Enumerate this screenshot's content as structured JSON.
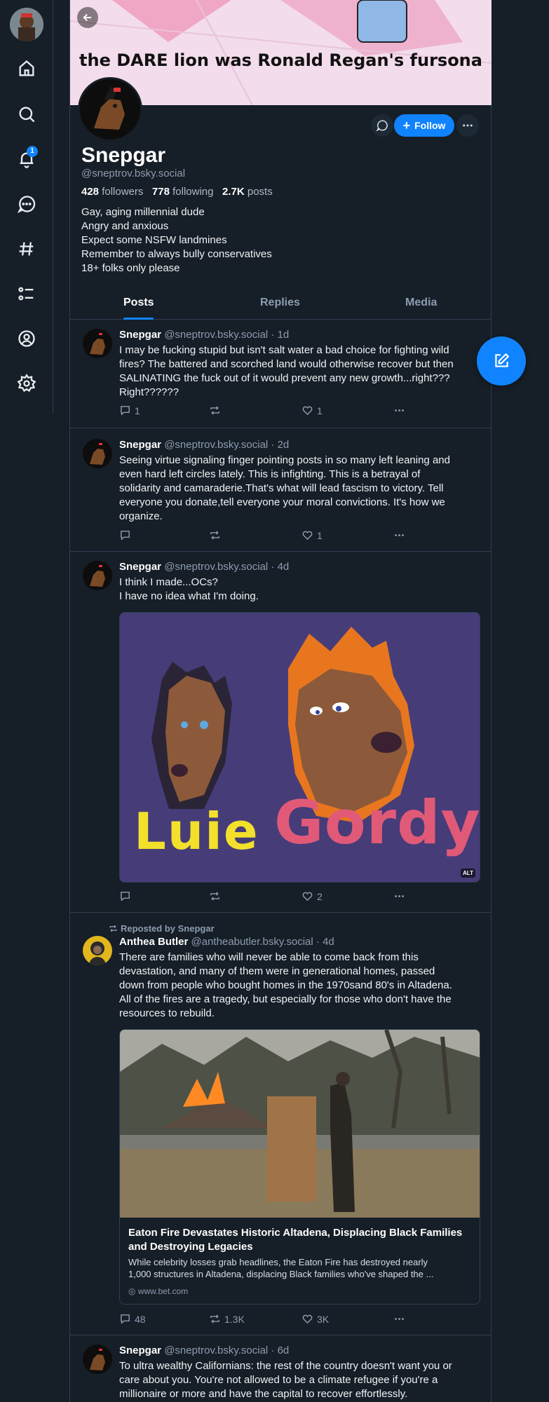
{
  "banner": {
    "text": "the DARE lion was Ronald Regan's fursona"
  },
  "nav": {
    "notification_count": "1"
  },
  "profile": {
    "display_name": "Snepgar",
    "handle": "@sneptrov.bsky.social",
    "followers_count": "428",
    "followers_label": "followers",
    "following_count": "778",
    "following_label": "following",
    "posts_count": "2.7K",
    "posts_label": "posts",
    "bio": [
      "Gay, aging millennial dude",
      "Angry and anxious",
      "Expect some NSFW landmines",
      "Remember to always bully conservatives",
      "18+ folks only please"
    ],
    "follow_label": "Follow"
  },
  "tabs": [
    "Posts",
    "Replies",
    "Media"
  ],
  "posts": [
    {
      "author": "Snepgar",
      "handle": "@sneptrov.bsky.social",
      "time": "· 1d",
      "lines": [
        "I may be fucking stupid but isn't salt water a bad choice for fighting wild",
        "fires? The battered and scorched land would otherwise recover but then",
        "SALINATING the fuck out of it would prevent any new growth...right???",
        "Right??????"
      ],
      "replies": "1",
      "reposts": "",
      "likes": "1"
    },
    {
      "author": "Snepgar",
      "handle": "@sneptrov.bsky.social",
      "time": "· 2d",
      "lines": [
        "Seeing virtue signaling finger pointing posts in so many left leaning and",
        "even hard left circles lately. This is infighting. This is a betrayal of",
        "solidarity and camaraderie.That's what will lead fascism to victory. Tell",
        "everyone you donate,tell everyone your moral convictions. It's how we",
        "organize."
      ],
      "replies": "",
      "reposts": "",
      "likes": "1"
    },
    {
      "author": "Snepgar",
      "handle": "@sneptrov.bsky.social",
      "time": "· 4d",
      "lines": [
        "I think I made...OCs?",
        "I have no idea what I'm doing."
      ],
      "image_alt_badge": "ALT",
      "image_text_left": "Luie",
      "image_text_right": "Gordy",
      "replies": "",
      "reposts": "",
      "likes": "2"
    },
    {
      "repost_label": "Reposted by Snepgar",
      "author": "Anthea Butler",
      "handle": "@antheabutler.bsky.social",
      "time": "· 4d",
      "lines": [
        "There are families who will never be able to come back from this",
        "devastation, and many of them were in generational homes, passed",
        "down from people who bought homes in the 1970sand 80's in Altadena.",
        "All of the fires are a tragedy, but especially for those who don't have the",
        "resources to rebuild."
      ],
      "card_title": [
        "Eaton Fire Devastates Historic Altadena, Displacing Black Families",
        "and Destroying Legacies"
      ],
      "card_desc": [
        "While celebrity losses grab headlines, the Eaton Fire has destroyed nearly",
        "1,000 structures in Altadena, displacing Black families who've shaped the ..."
      ],
      "card_domain": "www.bet.com",
      "replies": "48",
      "reposts": "1.3K",
      "likes": "3K"
    },
    {
      "author": "Snepgar",
      "handle": "@sneptrov.bsky.social",
      "time": "· 6d",
      "lines": [
        "To ultra wealthy Californians: the rest of the country doesn't want you or",
        "care about you. You're not allowed to be a climate refugee if you're a",
        "millionaire or more and have the capital to recover effortlessly."
      ]
    }
  ],
  "colors": {
    "accent": "#1083fe",
    "background": "#161e27",
    "border": "#2e4052",
    "muted_text": "#8c9db0"
  },
  "icons": [
    "home-icon",
    "search-icon",
    "bell-icon",
    "chat-icon",
    "hashtag-icon",
    "list-icon",
    "profile-icon",
    "gear-icon",
    "compose-icon"
  ]
}
